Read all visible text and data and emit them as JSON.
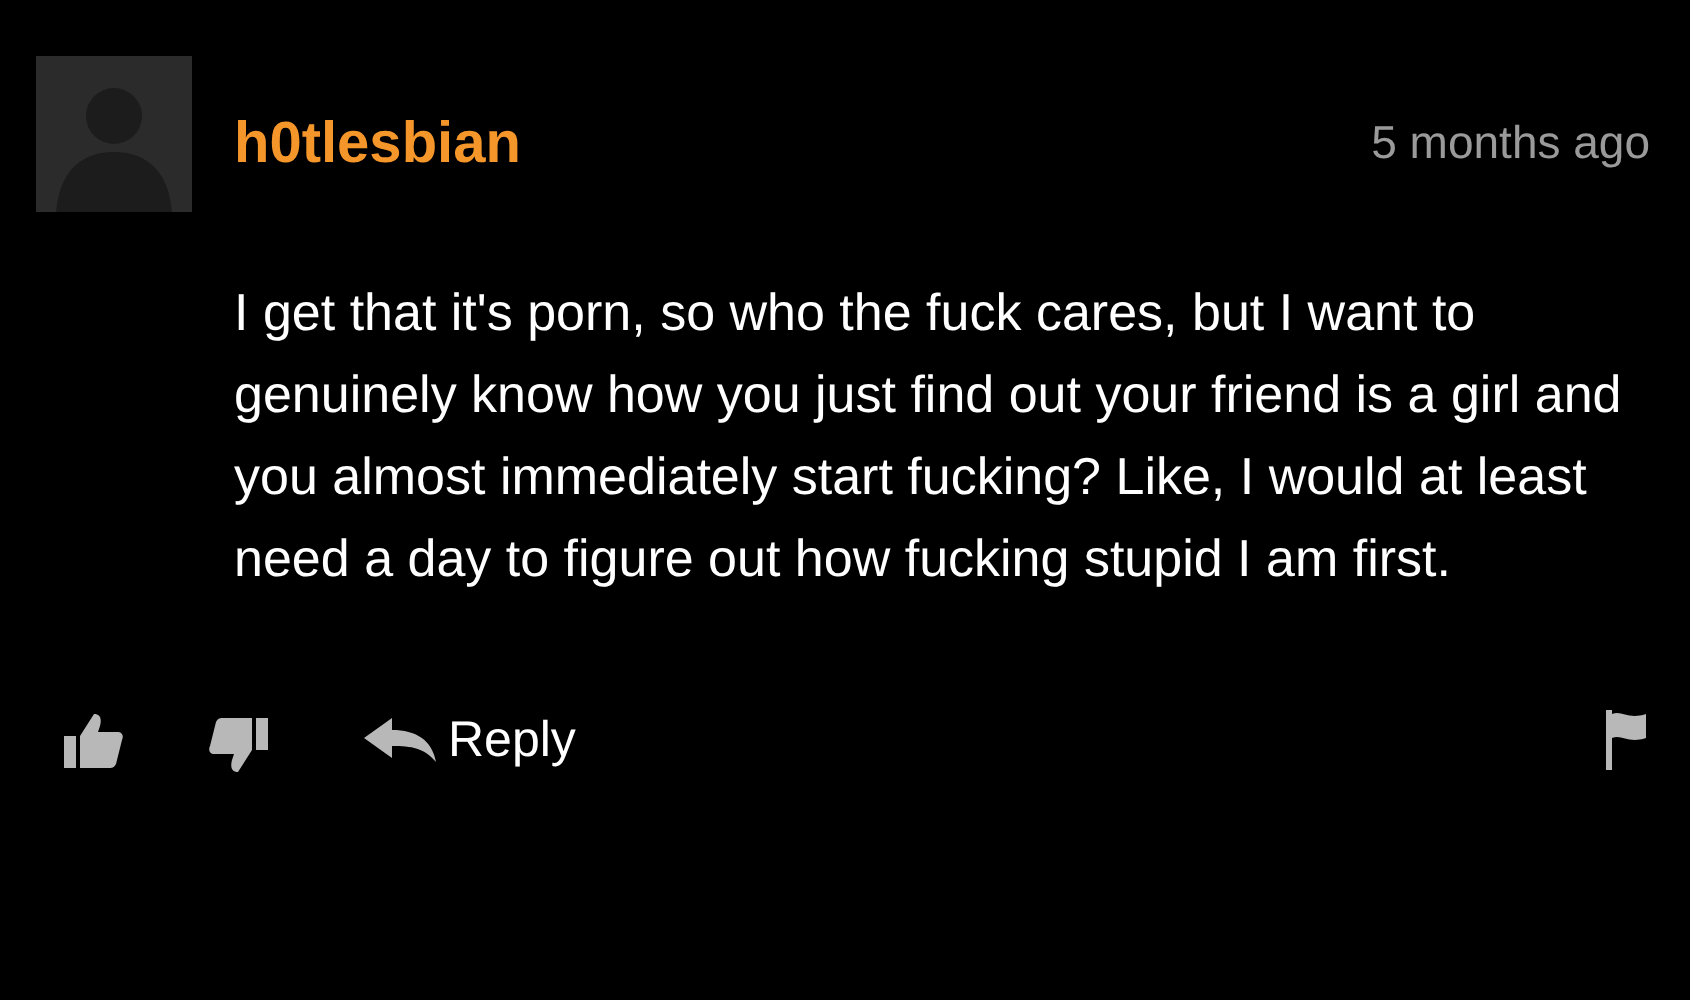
{
  "comment": {
    "username": "h0tlesbian",
    "time": "5 months ago",
    "body": "I get that it's porn, so who the fuck cares, but I want to genuinely know how you just find out your friend is a girl and you almost immediately start fucking? Like, I would at least need a day to figure out how fucking stupid I am first.",
    "reply_label": "Reply"
  }
}
